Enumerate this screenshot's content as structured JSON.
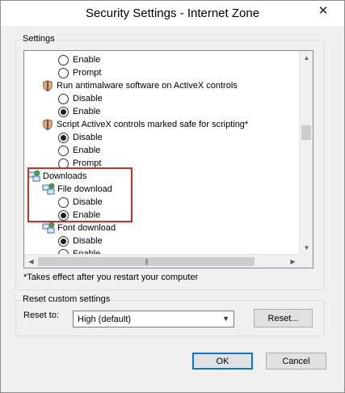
{
  "window": {
    "title": "Security Settings - Internet Zone",
    "close_glyph": "✕"
  },
  "settings_group": {
    "label": "Settings",
    "rows": [
      {
        "kind": "radio",
        "label": "Enable",
        "checked": false
      },
      {
        "kind": "radio",
        "label": "Prompt",
        "checked": false
      },
      {
        "kind": "setting",
        "label": "Run antimalware software on ActiveX controls",
        "icon": "shield-icon"
      },
      {
        "kind": "radio",
        "label": "Disable",
        "checked": false
      },
      {
        "kind": "radio",
        "label": "Enable",
        "checked": true
      },
      {
        "kind": "setting",
        "label": "Script ActiveX controls marked safe for scripting*",
        "icon": "shield-icon"
      },
      {
        "kind": "radio",
        "label": "Disable",
        "checked": true
      },
      {
        "kind": "radio",
        "label": "Enable",
        "checked": false
      },
      {
        "kind": "radio",
        "label": "Prompt",
        "checked": false
      },
      {
        "kind": "category",
        "label": "Downloads",
        "icon": "network-icon"
      },
      {
        "kind": "setting",
        "label": "File download",
        "icon": "network-icon"
      },
      {
        "kind": "radio",
        "label": "Disable",
        "checked": false
      },
      {
        "kind": "radio",
        "label": "Enable",
        "checked": true
      },
      {
        "kind": "setting",
        "label": "Font download",
        "icon": "network-icon"
      },
      {
        "kind": "radio",
        "label": "Disable",
        "checked": true
      },
      {
        "kind": "radio",
        "label": "Enable",
        "checked": false
      }
    ],
    "note": "*Takes effect after you restart your computer"
  },
  "reset_group": {
    "label": "Reset custom settings",
    "reset_to_label": "Reset to:",
    "reset_to_value": "High (default)",
    "reset_button": "Reset..."
  },
  "footer": {
    "ok_label": "OK",
    "cancel_label": "Cancel"
  },
  "colors": {
    "highlight": "#c9302c",
    "accent": "#0078d7"
  }
}
